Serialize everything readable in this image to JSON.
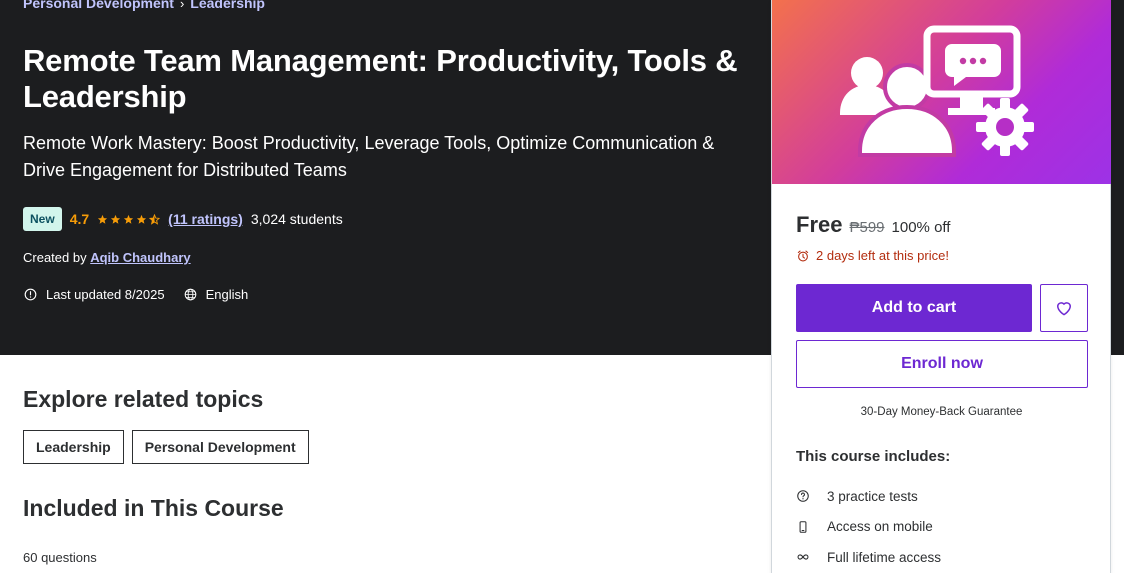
{
  "breadcrumb": {
    "items": [
      "Personal Development",
      "Leadership"
    ],
    "separator": "›"
  },
  "course": {
    "title": "Remote Team Management: Productivity, Tools & Leadership",
    "subtitle": "Remote Work Mastery: Boost Productivity, Leverage Tools, Optimize Communication & Drive Engagement for Distributed Teams",
    "badge": "New",
    "rating": "4.7",
    "rating_value": 4.7,
    "ratings_link": "(11 ratings)",
    "students": "3,024 students",
    "created_by_label": "Created by",
    "instructor": "Aqib Chaudhary",
    "last_updated": "Last updated 8/2025",
    "language": "English"
  },
  "explore": {
    "title": "Explore related topics",
    "topics": [
      "Leadership",
      "Personal Development"
    ]
  },
  "included": {
    "title": "Included in This Course",
    "questions": "60 questions"
  },
  "sidebar": {
    "price": "Free",
    "original_price": "₱599",
    "discount": "100% off",
    "timer": "2 days left at this price!",
    "add_to_cart": "Add to cart",
    "enroll": "Enroll now",
    "guarantee": "30-Day Money-Back Guarantee",
    "includes_title": "This course includes:",
    "includes": [
      {
        "icon": "question-circle-icon",
        "label": "3 practice tests"
      },
      {
        "icon": "mobile-phone-icon",
        "label": "Access on mobile"
      },
      {
        "icon": "infinity-icon",
        "label": "Full lifetime access"
      }
    ]
  },
  "colors": {
    "hero_bg": "#1c1d1f",
    "accent": "#6d28d2",
    "link": "#c0c4fc",
    "star": "#f69c08",
    "badge_bg": "#d2f5ec",
    "badge_text": "#0d5261",
    "timer": "#b32d0f"
  }
}
